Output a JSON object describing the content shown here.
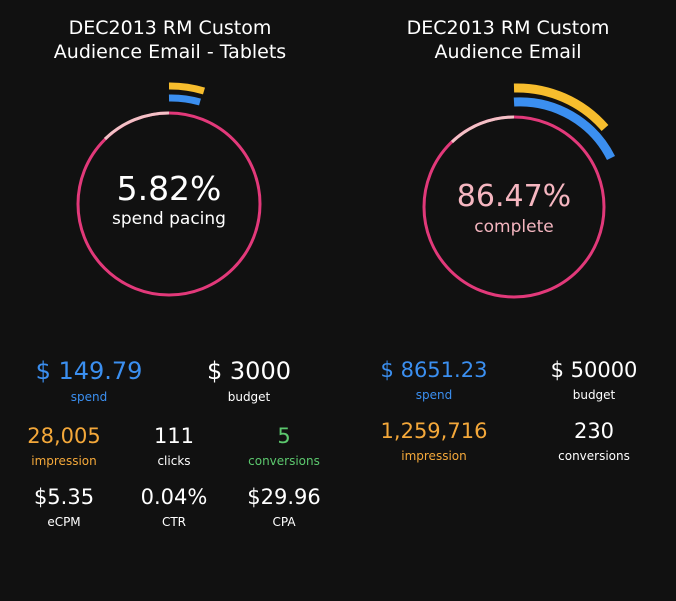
{
  "colors": {
    "background": "#111111",
    "ring": "#e2397a",
    "ring_light": "#f3c1c6",
    "blue": "#3b8ff0",
    "yellow": "#f7bd2d",
    "orange": "#f4a83a",
    "green": "#5cc86e",
    "pink_text": "#f5b6c0"
  },
  "left": {
    "title_line1": "DEC2013 RM Custom",
    "title_line2": "Audience Email - Tablets",
    "gauge": {
      "value": "5.82%",
      "label": "spend pacing",
      "pacing_fraction": 0.0582
    },
    "spend": {
      "value": "$ 149.79",
      "label": "spend"
    },
    "budget": {
      "value": "$ 3000",
      "label": "budget"
    },
    "impression": {
      "value": "28,005",
      "label": "impression"
    },
    "clicks": {
      "value": "111",
      "label": "clicks"
    },
    "conversions": {
      "value": "5",
      "label": "conversions"
    },
    "ecpm": {
      "value": "$5.35",
      "label": "eCPM"
    },
    "ctr": {
      "value": "0.04%",
      "label": "CTR"
    },
    "cpa": {
      "value": "$29.96",
      "label": "CPA"
    }
  },
  "right": {
    "title_line1": "DEC2013 RM Custom",
    "title_line2": "Audience Email",
    "gauge": {
      "value": "86.47%",
      "label": "complete"
    },
    "spend": {
      "value": "$ 8651.23",
      "label": "spend"
    },
    "budget": {
      "value": "$ 50000",
      "label": "budget"
    },
    "impression": {
      "value": "1,259,716",
      "label": "impression"
    },
    "conversions": {
      "value": "230",
      "label": "conversions"
    }
  }
}
